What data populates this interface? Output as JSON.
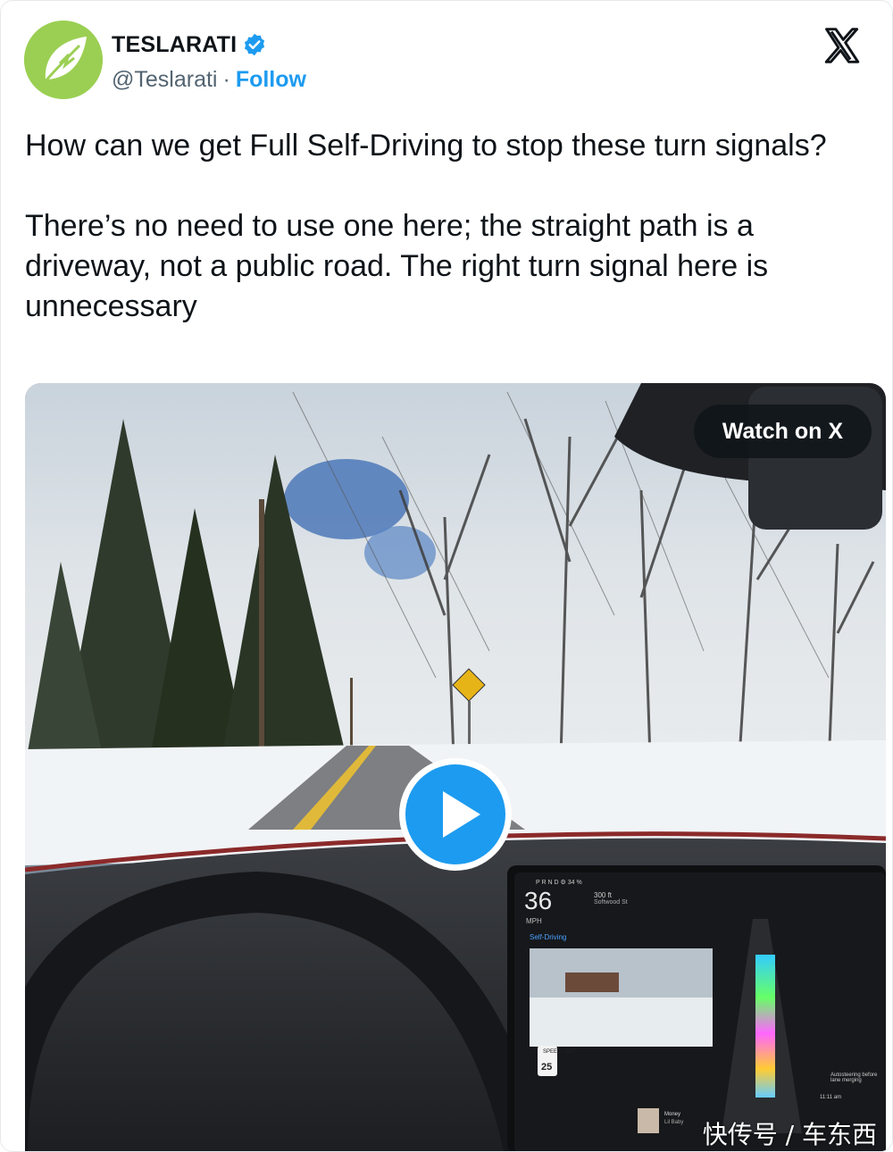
{
  "author": {
    "name": "TESLARATI",
    "handle": "@Teslarati",
    "separator": "·",
    "follow_label": "Follow",
    "verified": true,
    "verified_color": "#1d9bf0",
    "avatar_color": "#9bcf53"
  },
  "tweet": {
    "paragraph_1": "How can we get Full Self-Driving to stop these turn signals?",
    "paragraph_2": "There’s no need to use one here; the straight path is a driveway, not a public road. The right turn signal here is unnecessary"
  },
  "media": {
    "watch_label": "Watch on X",
    "play_icon": "play-icon",
    "accent_color": "#1d9bf0",
    "car_screen": {
      "status_bar": "P R N D   ⚙   34 %",
      "speed": "36",
      "speed_unit": "MPH",
      "fsd_label": "Self-Driving",
      "distance": "300 ft",
      "street": "Softwood St",
      "speed_limit_top": "SPEED LIMIT",
      "speed_limit": "25",
      "nav_notice": "Autosteering before lane merging",
      "clock": "11:11 am",
      "media_title": "Money",
      "media_artist": "Lil Baby"
    }
  },
  "watermark": "快传号 / 车东西"
}
